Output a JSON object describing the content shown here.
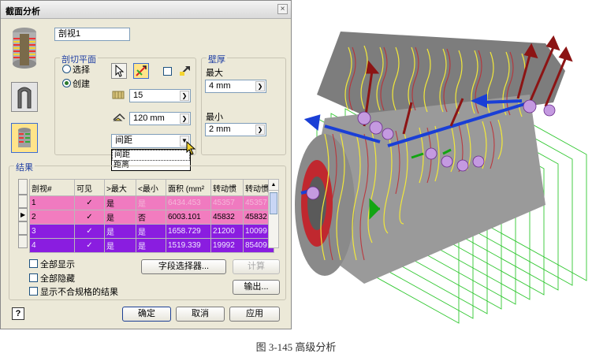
{
  "dialog": {
    "title": "截面分析",
    "close_glyph": "×",
    "view_name": "剖视1",
    "section_plane": {
      "group_label": "剖切平面",
      "radio_select": "选择",
      "radio_create": "创建",
      "offset_value": "15",
      "rotation_value": "120 mm",
      "dropdown_selected": "间距",
      "dropdown_options": [
        "间距",
        "距离"
      ]
    },
    "wall_thickness": {
      "group_label": "壁厚",
      "max_label": "最大",
      "max_value": "4 mm",
      "min_label": "最小",
      "min_value": "2 mm"
    },
    "results": {
      "group_label": "结果",
      "columns": [
        "剖视#",
        "可见",
        ">最大",
        "<最小",
        "面积 (mm²",
        "转动惯",
        "转动惯"
      ],
      "rows": [
        {
          "id": "1",
          "visible": "✓",
          "gt_max": "是",
          "lt_min": "是",
          "area": "6434.453",
          "i1": "45357",
          "i2": "45357"
        },
        {
          "id": "2",
          "visible": "✓",
          "gt_max": "是",
          "lt_min": "否",
          "area": "6003.101",
          "i1": "45832",
          "i2": "45832"
        },
        {
          "id": "3",
          "visible": "✓",
          "gt_max": "是",
          "lt_min": "是",
          "area": "1658.729",
          "i1": "21200",
          "i2": "10099"
        },
        {
          "id": "4",
          "visible": "✓",
          "gt_max": "是",
          "lt_min": "是",
          "area": "1519.339",
          "i1": "19992",
          "i2": "85409"
        }
      ],
      "show_all": "全部显示",
      "hide_all": "全部隐藏",
      "show_noncompliant": "显示不合规格的结果",
      "field_selector_button": "字段选择器...",
      "compute_button": "计算",
      "export_button": "输出..."
    },
    "footer": {
      "help_glyph": "?",
      "ok_button": "确定",
      "cancel_button": "取消",
      "apply_button": "应用"
    }
  },
  "caption": "图 3-145  高级分析",
  "colors": {
    "row_pink": "#f07ac0",
    "row_purple": "#8a1de0",
    "dialog_bg": "#ece9d8",
    "group_label": "#1f3fa3",
    "mesh_green": "#1cc21c",
    "section_red": "#c0282f",
    "section_yellow": "#f2e83a"
  }
}
